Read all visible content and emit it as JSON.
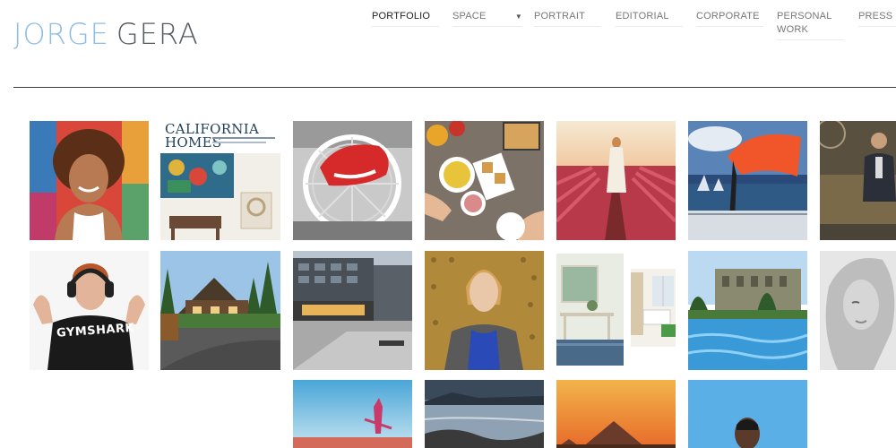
{
  "brand": {
    "first": "JORGE",
    "last": "GERA"
  },
  "nav": {
    "items": [
      {
        "label": "PORTFOLIO",
        "active": true
      },
      {
        "label": "SPACE",
        "has_dropdown": true
      },
      {
        "label": "PORTRAIT"
      },
      {
        "label": "EDITORIAL"
      },
      {
        "label": "CORPORATE"
      },
      {
        "label": "PERSONAL WORK"
      },
      {
        "label": "PRESS"
      }
    ]
  },
  "gallery": {
    "cover": {
      "line1": "CALIFORNIA",
      "line2": "HOMES"
    },
    "shirt_text": "GYMSHARK"
  },
  "colors": {
    "logo_accent": "#8fbde3",
    "logo_dark": "#555b60",
    "rule": "#3a3a3a"
  }
}
